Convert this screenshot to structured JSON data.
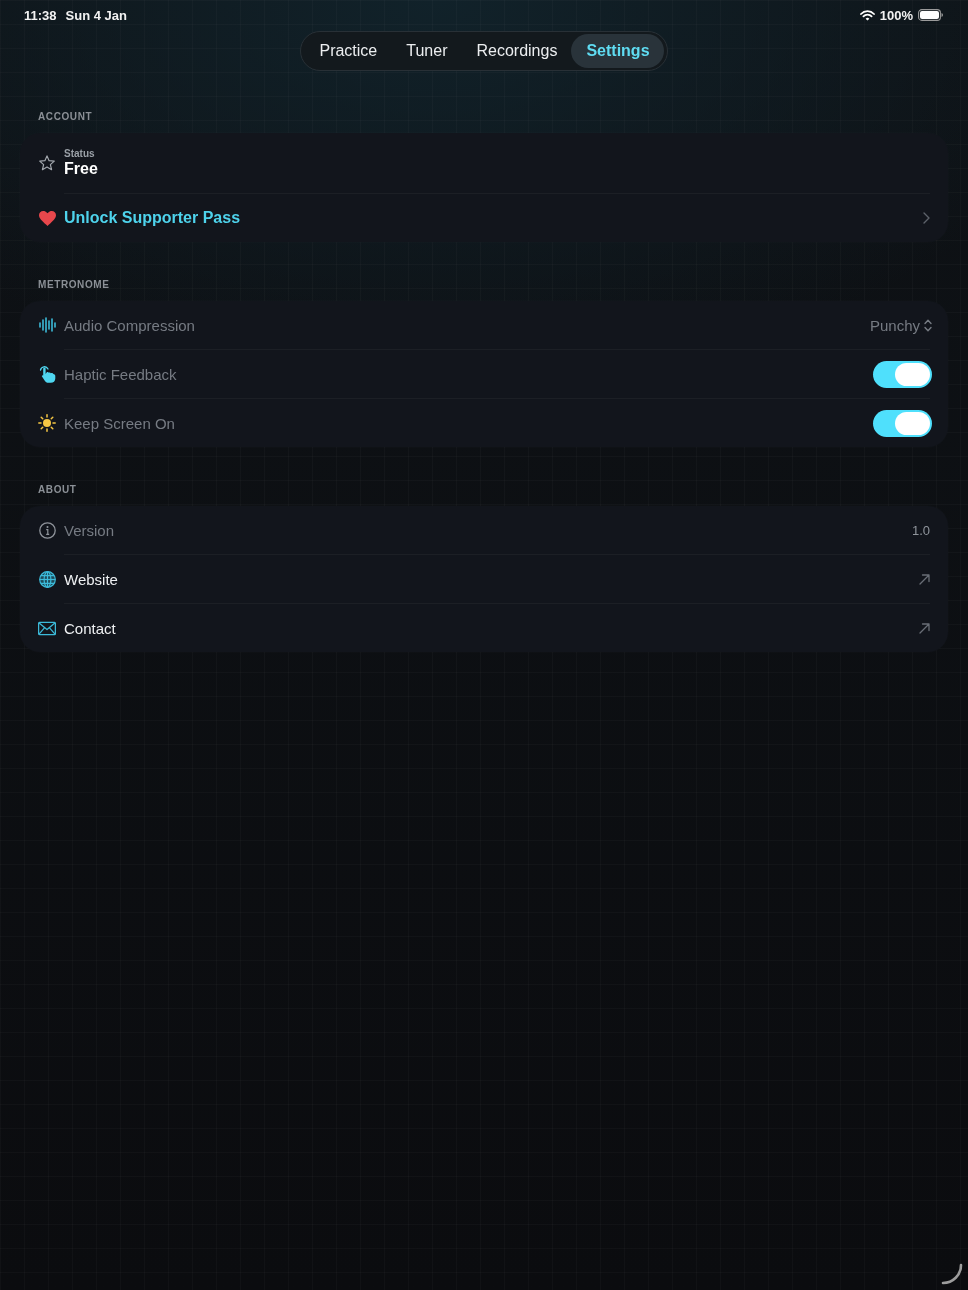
{
  "status_bar": {
    "time": "11:38",
    "date": "Sun 4 Jan",
    "battery": "100%"
  },
  "tabs": [
    {
      "label": "Practice",
      "selected": false
    },
    {
      "label": "Tuner",
      "selected": false
    },
    {
      "label": "Recordings",
      "selected": false
    },
    {
      "label": "Settings",
      "selected": true
    }
  ],
  "sections": [
    {
      "title": "ACCOUNT",
      "rows": [
        {
          "kind": "status",
          "label": "Status",
          "value": "Free"
        },
        {
          "kind": "action",
          "label": "Unlock Supporter Pass"
        }
      ]
    },
    {
      "title": "METRONOME",
      "rows": [
        {
          "kind": "picker",
          "label": "Audio Compression",
          "value": "Punchy"
        },
        {
          "kind": "toggle",
          "label": "Haptic Feedback",
          "on": true
        },
        {
          "kind": "toggle",
          "label": "Keep Screen On",
          "on": true
        }
      ]
    },
    {
      "title": "ABOUT",
      "rows": [
        {
          "kind": "info",
          "label": "Version",
          "value": "1.0"
        },
        {
          "kind": "link",
          "label": "Website"
        },
        {
          "kind": "link",
          "label": "Contact"
        }
      ]
    }
  ]
}
